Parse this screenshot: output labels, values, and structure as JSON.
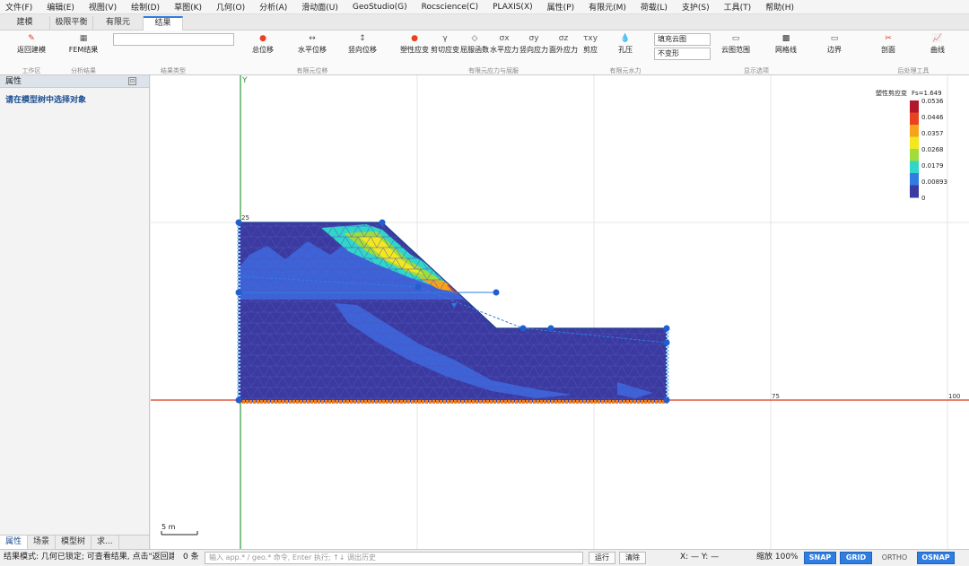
{
  "menu": [
    "文件(F)",
    "编辑(E)",
    "视图(V)",
    "绘制(D)",
    "草图(K)",
    "几何(O)",
    "分析(A)",
    "滑动面(U)",
    "GeoStudio(G)",
    "Rocscience(C)",
    "PLAXIS(X)",
    "属性(P)",
    "有限元(M)",
    "荷载(L)",
    "支护(S)",
    "工具(T)",
    "帮助(H)"
  ],
  "tabs": [
    "建模",
    "极限平衡",
    "有限元",
    "结果"
  ],
  "ribbon": {
    "back_label": "返回建模",
    "fem_label": "FEM结果",
    "result_type_value": "",
    "disp_total": "总位移",
    "disp_h": "水平位移",
    "disp_v": "竖向位移",
    "plastic": "塑性应变",
    "gamma_sym": "γ",
    "shear": "剪切应变",
    "yield_sym": "◇",
    "yield": "屈服函数",
    "sx_sym": "σx",
    "sx": "水平应力",
    "sy_sym": "σy",
    "sy": "竖向应力",
    "sz_sym": "σz",
    "sz": "面外应力",
    "txy_sym": "τxy",
    "txy": "剪应",
    "pore": "孔压",
    "fill_select": "填充云图",
    "deform_select": "不变形",
    "contour_range": "云图范围",
    "mesh_lines": "网格线",
    "boundary": "边界",
    "section": "剖面",
    "curve": "曲线",
    "groups": {
      "workspace": "工作区",
      "analysis": "分析结果",
      "result_type": "结果类型",
      "fem_disp": "有限元位移",
      "fem_stress": "有限元应力与屈服",
      "fem_water": "有限元水力",
      "display": "显示选项",
      "post": "后处理工具"
    }
  },
  "left_panel": {
    "title": "属性",
    "message": "请在模型树中选择对象",
    "tabs": [
      "属性",
      "场景",
      "模型树",
      "求..."
    ]
  },
  "canvas": {
    "y_axis_label": "Y",
    "x_label_75": "75",
    "x_label_100": "100",
    "y_label_25": "25",
    "scale_label": "5 m",
    "colors": {
      "axis_y": "#2e9a3a",
      "axis_x": "#d9381e",
      "mesh_base": "#3a3aa0",
      "node": "#1f5fd0"
    }
  },
  "legend": {
    "title": "塑性剪应变",
    "fs": "Fs=1.649",
    "values": [
      "0.0536",
      "0.0446",
      "0.0357",
      "0.0268",
      "0.0179",
      "0.00893",
      "0"
    ],
    "colors": [
      "#b2182b",
      "#e8421e",
      "#f7a21b",
      "#f3e71f",
      "#9fdc3c",
      "#2fd6c9",
      "#2f7de1",
      "#3a3aa0"
    ]
  },
  "status": {
    "mode_text": "结果模式: 几何已锁定; 可查看结果, 点击\"返回建模",
    "count": "0 条",
    "cmd_placeholder": "输入 app.* / geo.* 命令, Enter 执行; ↑↓ 调出历史",
    "run": "运行",
    "clear": "清除",
    "coords": "X: —   Y: —",
    "zoom": "缩放 100%",
    "snap": "SNAP",
    "grid": "GRID",
    "ortho": "ORTHO",
    "osnap": "OSNAP"
  }
}
